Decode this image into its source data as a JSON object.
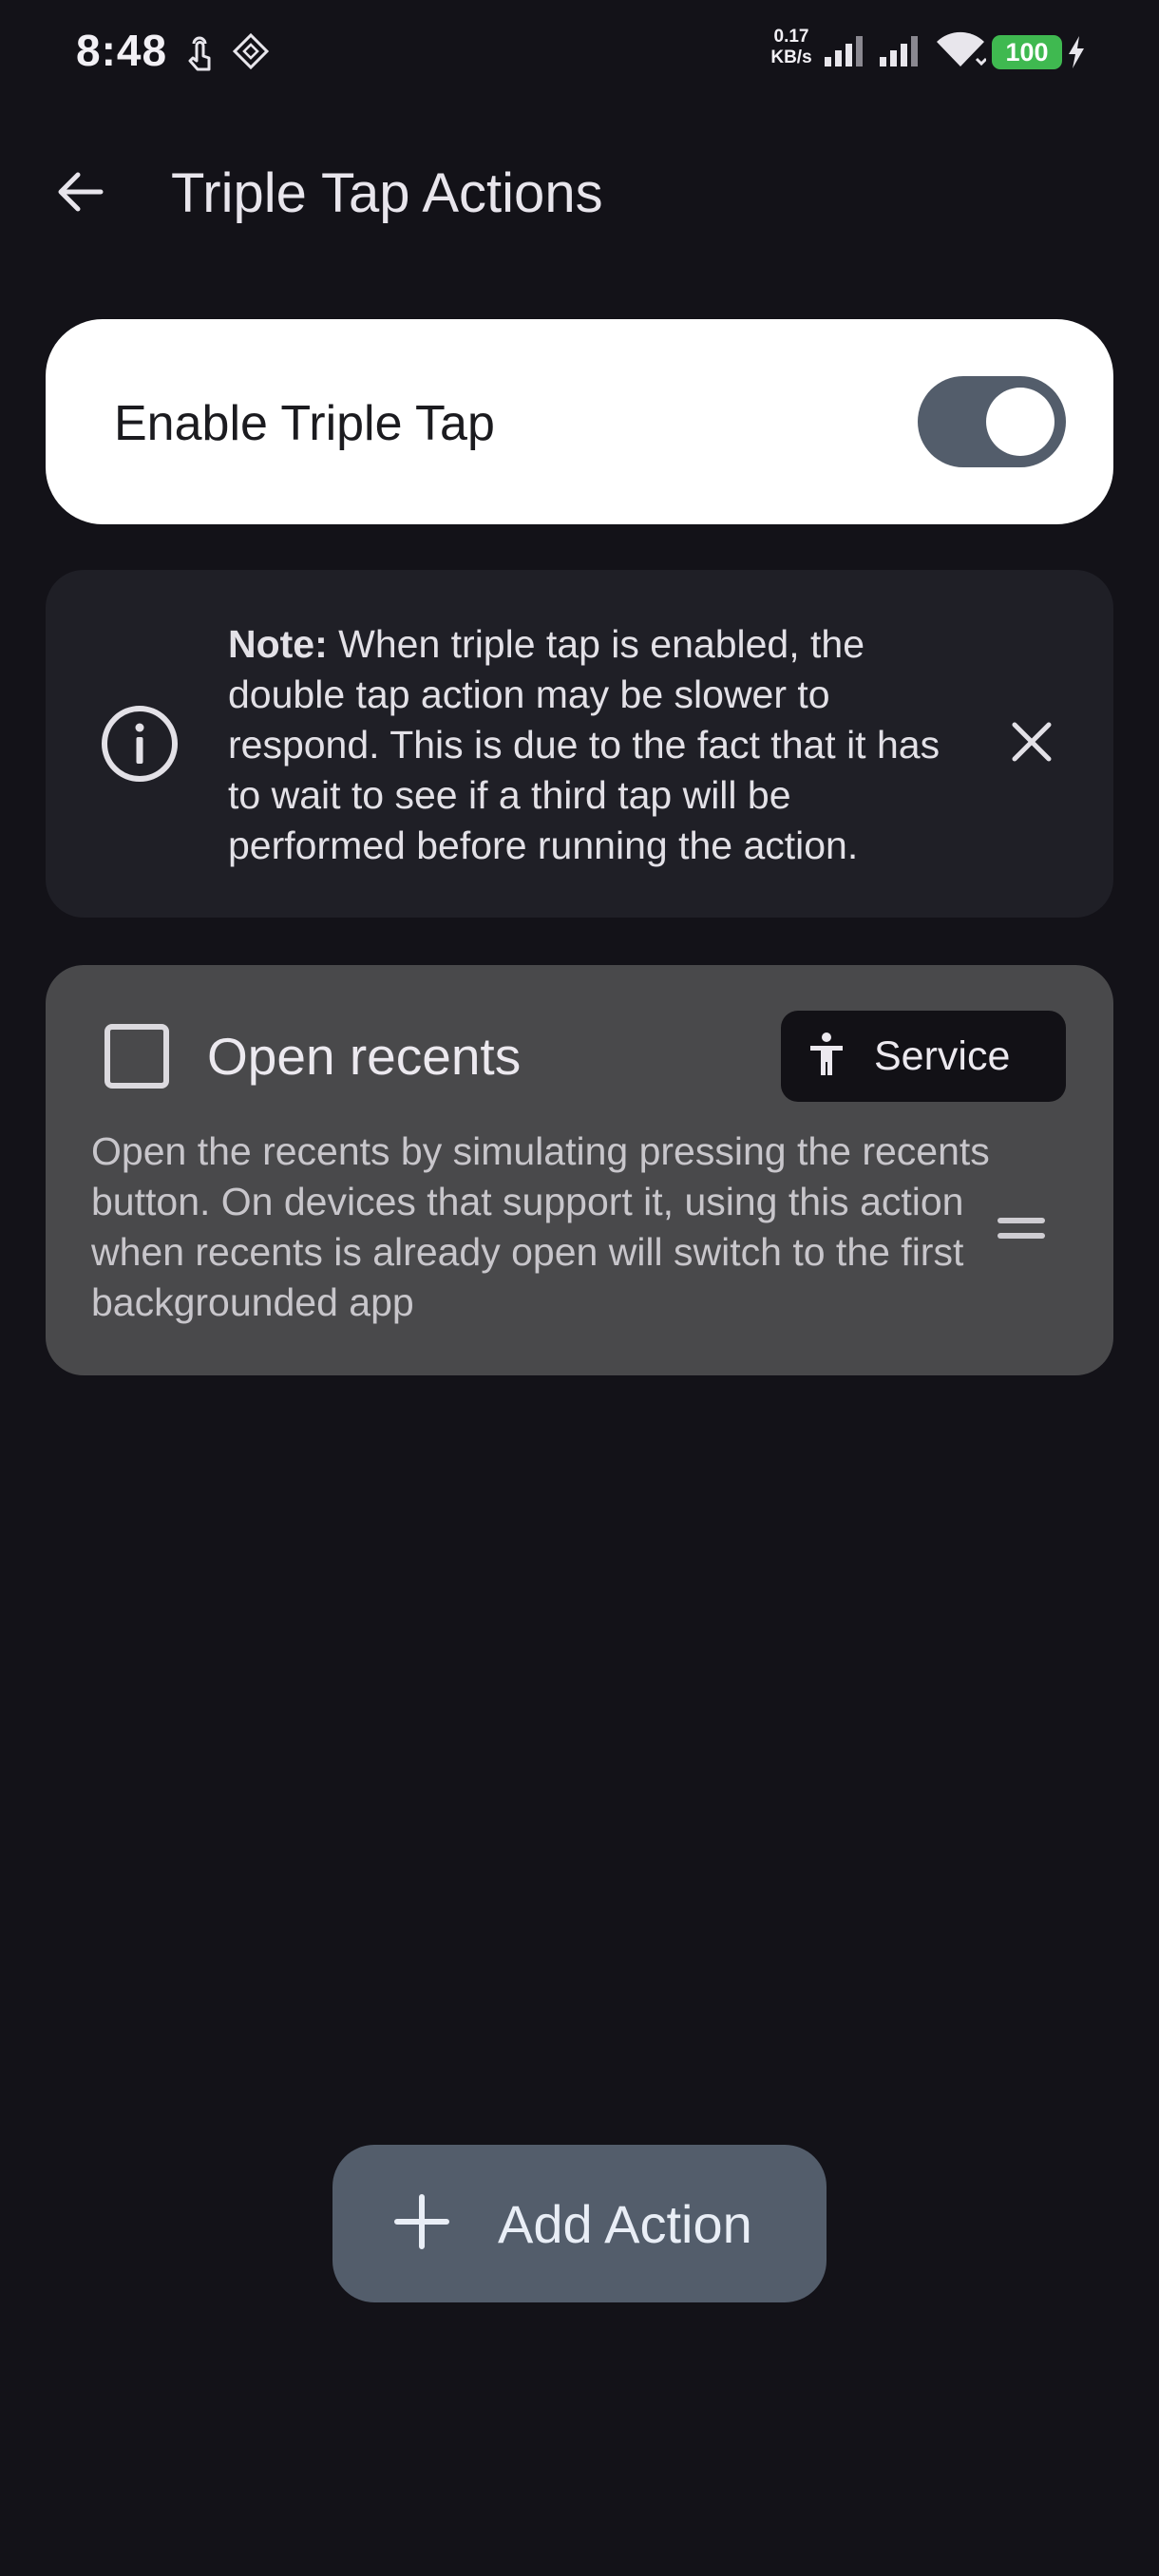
{
  "status_bar": {
    "time": "8:48",
    "net_speed_value": "0.17",
    "net_speed_unit": "KB/s",
    "battery": "100",
    "icons": [
      "touch-icon",
      "diamond-app-icon",
      "signal-1-icon",
      "signal-2-icon",
      "wifi-icon",
      "charging-bolt-icon"
    ]
  },
  "app_bar": {
    "back_icon": "arrow-left-icon",
    "title": "Triple Tap Actions"
  },
  "enable_card": {
    "label": "Enable Triple Tap",
    "enabled": true
  },
  "note": {
    "bold_prefix": "Note:",
    "text": " When triple tap is enabled, the double tap action may be slower to respond. This is due to the fact that it has to wait to see if a third tap will be performed before running the action.",
    "icon": "info-icon",
    "close_icon": "close-icon"
  },
  "actions": [
    {
      "title": "Open recents",
      "checked": false,
      "chip_label": "Service",
      "chip_icon": "accessibility-icon",
      "description": "Open the recents by simulating pressing the recents button. On devices that support it, using this action when recents is already open will switch to the first backgrounded app",
      "handle_icon": "drag-handle-icon"
    }
  ],
  "fab": {
    "label": "Add Action",
    "icon": "plus-icon"
  },
  "colors": {
    "background": "#131218",
    "card_light": "#ffffff",
    "toggle_track": "#535d6b",
    "note_card": "#1f1f26",
    "action_card": "#49494b",
    "chip": "#121116",
    "fab": "#535d6b",
    "battery": "#3fb950"
  }
}
